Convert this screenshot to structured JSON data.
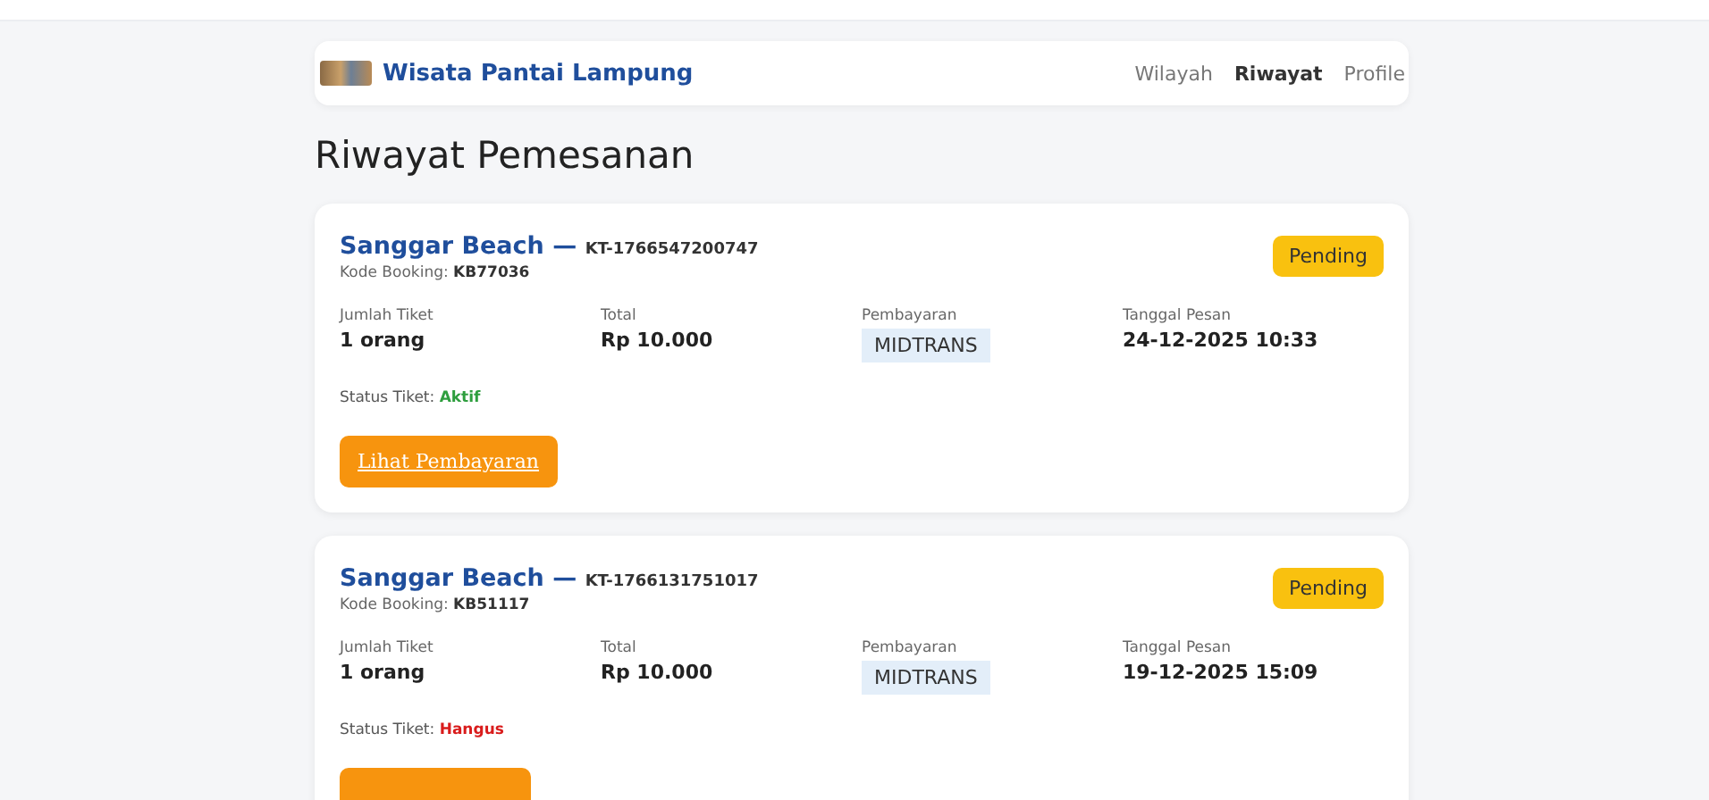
{
  "navbar": {
    "brand": "Wisata Pantai Lampung",
    "links": [
      {
        "label": "Wilayah",
        "selected": false
      },
      {
        "label": "Riwayat",
        "selected": true
      },
      {
        "label": "Profile",
        "selected": false
      }
    ]
  },
  "page_title": "Riwayat Pemesanan",
  "bookings": [
    {
      "destination": "Sanggar Beach",
      "separator": "—",
      "ticket_code": "KT-1766547200747",
      "booking_label": "Kode Booking:",
      "booking_code": "KB77036",
      "status_badge": "Pending",
      "fields": [
        {
          "label": "Jumlah Tiket",
          "value": "1 orang",
          "kind": "text"
        },
        {
          "label": "Total",
          "value": "Rp 10.000",
          "kind": "text"
        },
        {
          "label": "Pembayaran",
          "value": "MIDTRANS",
          "kind": "chip"
        },
        {
          "label": "Tanggal Pesan",
          "value": "24-12-2025 10:33",
          "kind": "text"
        }
      ],
      "status_label": "Status Tiket:",
      "ticket_status": "Aktif",
      "color": "#2e9e3e",
      "button_label": "Lihat Pembayaran"
    },
    {
      "destination": "Sanggar Beach",
      "separator": "—",
      "ticket_code": "KT-1766131751017",
      "booking_label": "Kode Booking:",
      "booking_code": "KB51117",
      "status_badge": "Pending",
      "fields": [
        {
          "label": "Jumlah Tiket",
          "value": "1 orang",
          "kind": "text"
        },
        {
          "label": "Total",
          "value": "Rp 10.000",
          "kind": "text"
        },
        {
          "label": "Pembayaran",
          "value": "MIDTRANS",
          "kind": "chip"
        },
        {
          "label": "Tanggal Pesan",
          "value": "19-12-2025 15:09",
          "kind": "text"
        }
      ],
      "status_label": "Status Tiket:",
      "ticket_status": "Hangus",
      "color": "#d91c1c"
    }
  ]
}
